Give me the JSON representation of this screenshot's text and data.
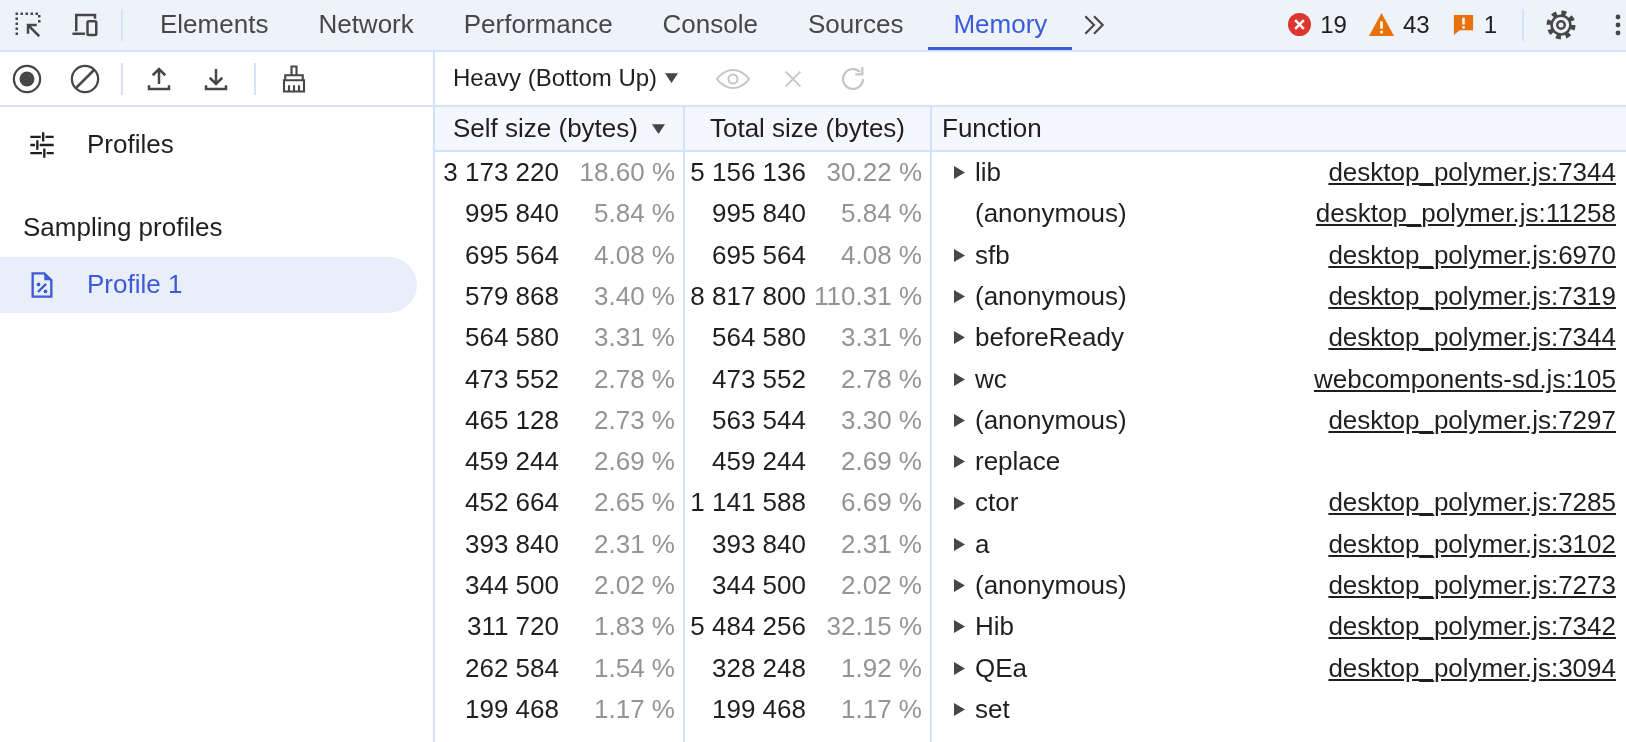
{
  "main_tabs": [
    {
      "label": "Elements",
      "selected": false
    },
    {
      "label": "Network",
      "selected": false
    },
    {
      "label": "Performance",
      "selected": false
    },
    {
      "label": "Console",
      "selected": false
    },
    {
      "label": "Sources",
      "selected": false
    },
    {
      "label": "Memory",
      "selected": true
    }
  ],
  "status_counts": [
    {
      "kind": "error",
      "count": "19"
    },
    {
      "kind": "warning",
      "count": "43"
    },
    {
      "kind": "issue",
      "count": "1"
    }
  ],
  "sidebar": {
    "launcher": {
      "label": "Profiles",
      "selected": false
    },
    "sections": [
      {
        "title": "Sampling profiles",
        "profiles": [
          {
            "label": "Profile 1",
            "selected": true
          }
        ]
      }
    ]
  },
  "view_select": {
    "value": "Heavy (Bottom Up)"
  },
  "view_actions": [
    {
      "kind": "focus",
      "disabled": true
    },
    {
      "kind": "exclude",
      "disabled": true
    },
    {
      "kind": "restore",
      "disabled": true
    }
  ],
  "table": {
    "columns": [
      {
        "label": "Self size (bytes)",
        "sorted": true
      },
      {
        "label": "Total size (bytes)",
        "sorted": false
      },
      {
        "label": "Function",
        "sorted": false
      }
    ],
    "rows": [
      {
        "self_size": "3 173 220",
        "self_percent": "18.60 %",
        "total_size": "5 156 136",
        "total_percent": "30.22 %",
        "function": "lib",
        "expandable": true,
        "source": "desktop_polymer.js:7344"
      },
      {
        "self_size": "995 840",
        "self_percent": "5.84 %",
        "total_size": "995 840",
        "total_percent": "5.84 %",
        "function": "(anonymous)",
        "expandable": false,
        "source": "desktop_polymer.js:11258"
      },
      {
        "self_size": "695 564",
        "self_percent": "4.08 %",
        "total_size": "695 564",
        "total_percent": "4.08 %",
        "function": "sfb",
        "expandable": true,
        "source": "desktop_polymer.js:6970"
      },
      {
        "self_size": "579 868",
        "self_percent": "3.40 %",
        "total_size": "8 817 800",
        "total_percent": "110.31 %",
        "function": "(anonymous)",
        "expandable": true,
        "source": "desktop_polymer.js:7319"
      },
      {
        "self_size": "564 580",
        "self_percent": "3.31 %",
        "total_size": "564 580",
        "total_percent": "3.31 %",
        "function": "beforeReady",
        "expandable": true,
        "source": "desktop_polymer.js:7344"
      },
      {
        "self_size": "473 552",
        "self_percent": "2.78 %",
        "total_size": "473 552",
        "total_percent": "2.78 %",
        "function": "wc",
        "expandable": true,
        "source": "webcomponents-sd.js:105"
      },
      {
        "self_size": "465 128",
        "self_percent": "2.73 %",
        "total_size": "563 544",
        "total_percent": "3.30 %",
        "function": "(anonymous)",
        "expandable": true,
        "source": "desktop_polymer.js:7297"
      },
      {
        "self_size": "459 244",
        "self_percent": "2.69 %",
        "total_size": "459 244",
        "total_percent": "2.69 %",
        "function": "replace",
        "expandable": true
      },
      {
        "self_size": "452 664",
        "self_percent": "2.65 %",
        "total_size": "1 141 588",
        "total_percent": "6.69 %",
        "function": "ctor",
        "expandable": true,
        "source": "desktop_polymer.js:7285"
      },
      {
        "self_size": "393 840",
        "self_percent": "2.31 %",
        "total_size": "393 840",
        "total_percent": "2.31 %",
        "function": "a",
        "expandable": true,
        "source": "desktop_polymer.js:3102"
      },
      {
        "self_size": "344 500",
        "self_percent": "2.02 %",
        "total_size": "344 500",
        "total_percent": "2.02 %",
        "function": "(anonymous)",
        "expandable": true,
        "source": "desktop_polymer.js:7273"
      },
      {
        "self_size": "311 720",
        "self_percent": "1.83 %",
        "total_size": "5 484 256",
        "total_percent": "32.15 %",
        "function": "Hib",
        "expandable": true,
        "source": "desktop_polymer.js:7342"
      },
      {
        "self_size": "262 584",
        "self_percent": "1.54 %",
        "total_size": "328 248",
        "total_percent": "1.92 %",
        "function": "QEa",
        "expandable": true,
        "source": "desktop_polymer.js:3094"
      },
      {
        "self_size": "199 468",
        "self_percent": "1.17 %",
        "total_size": "199 468",
        "total_percent": "1.17 %",
        "function": "set",
        "expandable": true
      }
    ]
  }
}
